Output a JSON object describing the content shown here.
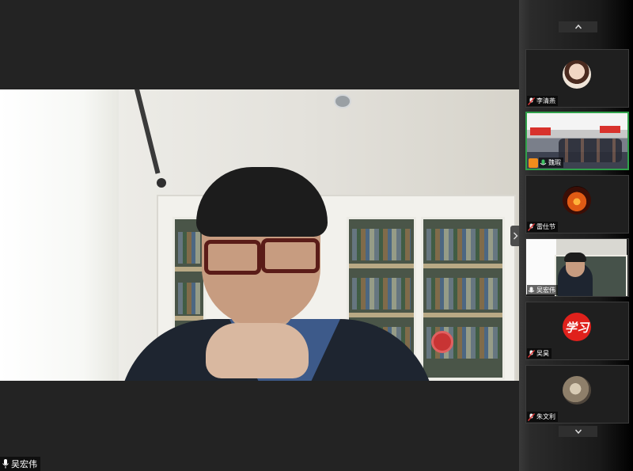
{
  "main": {
    "speaker_name": "吴宏伟",
    "mic_icon": "microphone-icon",
    "corner_icon_text": "@。",
    "collapse_icon": "chevron-right-icon"
  },
  "sidebar": {
    "scroll_up_icon": "chevron-up-icon",
    "scroll_down_icon": "chevron-down-icon",
    "tiles": [
      {
        "name": "李清燕",
        "avatar": "woman-portrait",
        "muted": true,
        "active": false
      },
      {
        "name": "魏瑕",
        "avatar": "meeting-room-video",
        "muted": false,
        "active": true,
        "sharing": true
      },
      {
        "name": "雷仕节",
        "avatar": "sunset-image",
        "muted": true,
        "active": false
      },
      {
        "name": "吴宏伟",
        "avatar": "self-video",
        "muted": false,
        "active": false
      },
      {
        "name": "吴昊",
        "avatar": "red-badge",
        "badge_text": "学习",
        "muted": true,
        "active": false
      },
      {
        "name": "朱文利",
        "avatar": "cat-photo",
        "muted": true,
        "active": false
      }
    ]
  },
  "colors": {
    "active_border": "#2fa04a",
    "background": "#232323",
    "badge_red": "#e0211c",
    "share_orange": "#f08c1c"
  }
}
